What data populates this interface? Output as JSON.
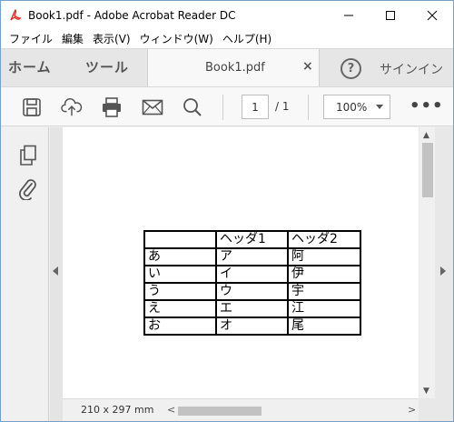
{
  "window": {
    "title": "Book1.pdf - Adobe Acrobat Reader DC",
    "app_icon": "acrobat-pdf-icon",
    "minimize": "—",
    "maximize": "☐",
    "close": "✕"
  },
  "menubar": {
    "items": [
      "ファイル",
      "編集",
      "表示(V)",
      "ウィンドウ(W)",
      "ヘルプ(H)"
    ]
  },
  "tabs": {
    "home": "ホーム",
    "tools": "ツール",
    "document": "Book1.pdf",
    "document_close": "×",
    "help": "?",
    "signin": "サインイン"
  },
  "toolbar": {
    "current_page": "1",
    "page_total": "/ 1",
    "zoom": "100%",
    "more": "•••",
    "icons": [
      "save-icon",
      "upload-cloud-icon",
      "print-icon",
      "mail-icon",
      "search-icon"
    ]
  },
  "left_rail": {
    "icons": [
      "copy-pages-icon",
      "paperclip-icon"
    ]
  },
  "document": {
    "table": {
      "header": [
        "",
        "ヘッダ1",
        "ヘッダ2"
      ],
      "rows": [
        [
          "あ",
          "ア",
          "阿"
        ],
        [
          "い",
          "イ",
          "伊"
        ],
        [
          "う",
          "ウ",
          "宇"
        ],
        [
          "え",
          "エ",
          "江"
        ],
        [
          "お",
          "オ",
          "尾"
        ]
      ]
    }
  },
  "status": {
    "page_size": "210 x 297 mm"
  },
  "colors": {
    "title_bg": "#ffffff",
    "tab_bar": "#e6e6e6",
    "acrobat_red": "#e0312e"
  }
}
